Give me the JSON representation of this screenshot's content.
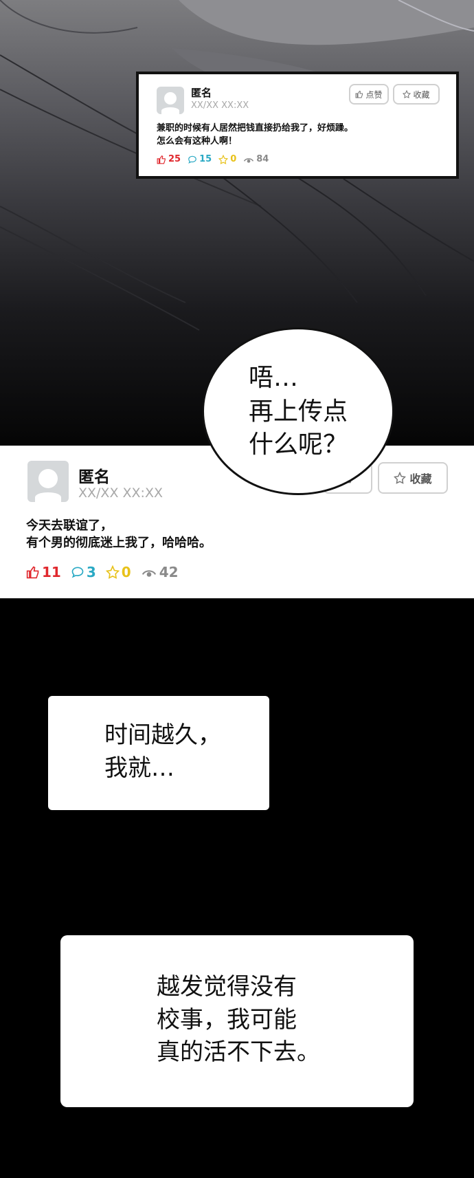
{
  "post_top": {
    "username": "匿名",
    "time": "XX/XX XX:XX",
    "like_button": "点赞",
    "favorite_button": "收藏",
    "line1": "兼职的时候有人居然把钱直接扔给我了，好烦躁。",
    "line2": "怎么会有这种人啊！",
    "likes": "25",
    "comments": "15",
    "stars": "0",
    "views": "84"
  },
  "bubble": {
    "text": "唔…\n再上传点\n什么呢？"
  },
  "post_main": {
    "username": "匿名",
    "time": "XX/XX XX:XX",
    "favorite_button": "收藏",
    "line1": "今天去联谊了，",
    "line2": "有个男的彻底迷上我了，哈哈哈。",
    "likes": "11",
    "comments": "3",
    "stars": "0",
    "views": "42"
  },
  "narration1": {
    "text": "时间越久，\n我就…"
  },
  "narration2": {
    "text": "越发觉得没有\n校事，我可能\n真的活不下去。"
  },
  "colors": {
    "like": "#e0282e",
    "comment": "#2aa9c4",
    "star": "#e8c21a",
    "view": "#8a8a8a"
  }
}
